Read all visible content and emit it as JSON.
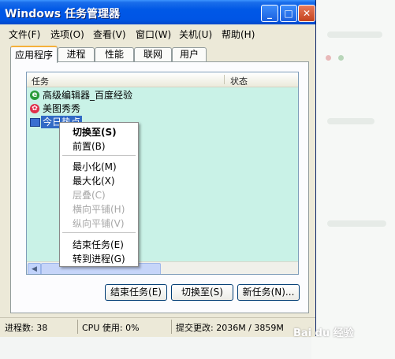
{
  "window": {
    "title": "Windows 任务管理器",
    "controls": {
      "minimize": "_",
      "maximize": "□",
      "close": "✕"
    }
  },
  "menubar": [
    "文件(F)",
    "选项(O)",
    "查看(V)",
    "窗口(W)",
    "关机(U)",
    "帮助(H)"
  ],
  "tabs": [
    "应用程序",
    "进程",
    "性能",
    "联网",
    "用户"
  ],
  "listview": {
    "columns": {
      "task": "任务",
      "status": "状态"
    },
    "rows": [
      {
        "label": "高级编辑器_百度经验",
        "icon": "ie-icon"
      },
      {
        "label": "美图秀秀",
        "icon": "meitu-icon"
      },
      {
        "label": "今日热点",
        "icon": "window-icon"
      }
    ]
  },
  "context_menu": {
    "switch_to": "切换至(S)",
    "bring_front": "前置(B)",
    "minimize": "最小化(M)",
    "maximize": "最大化(X)",
    "cascade": "层叠(C)",
    "tile_h": "横向平铺(H)",
    "tile_v": "纵向平铺(V)",
    "end_task": "结束任务(E)",
    "goto_process": "转到进程(G)"
  },
  "buttons": {
    "end_task": "结束任务(E)",
    "switch_to": "切换至(S)",
    "new_task": "新任务(N)..."
  },
  "statusbar": {
    "processes": "进程数: 38",
    "cpu": "CPU 使用: 0%",
    "commit": "提交更改: 2036M / 3859M"
  },
  "watermark": "Bai du 经验",
  "colors": {
    "titlebar": "#0058e6",
    "list_background": "#c9f2e7",
    "selection": "#316ac5"
  }
}
